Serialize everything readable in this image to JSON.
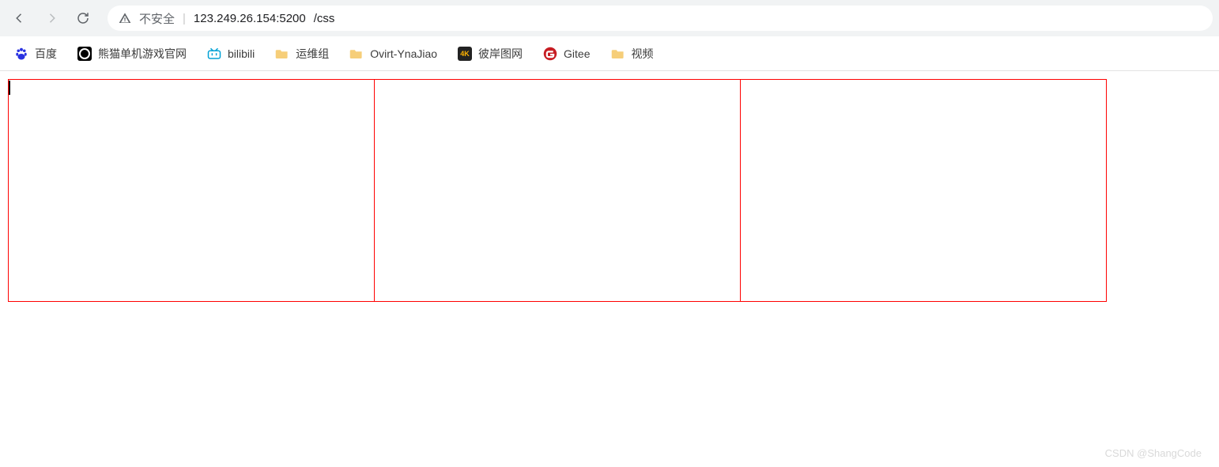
{
  "toolbar": {
    "not_secure_label": "不安全",
    "url_host": "123.249.26.154:5200",
    "url_path": "/css"
  },
  "bookmarks": [
    {
      "icon": "baidu",
      "label": "百度"
    },
    {
      "icon": "panda",
      "label": "熊猫单机游戏官网"
    },
    {
      "icon": "bilibili",
      "label": "bilibili"
    },
    {
      "icon": "folder",
      "label": "运维组"
    },
    {
      "icon": "folder",
      "label": "Ovirt-YnaJiao"
    },
    {
      "icon": "4k",
      "label": "彼岸图网"
    },
    {
      "icon": "gitee",
      "label": "Gitee"
    },
    {
      "icon": "folder",
      "label": "视频"
    }
  ],
  "page": {
    "box_count": 3,
    "box_border_color": "#ff0000"
  },
  "watermark": "CSDN @ShangCode"
}
